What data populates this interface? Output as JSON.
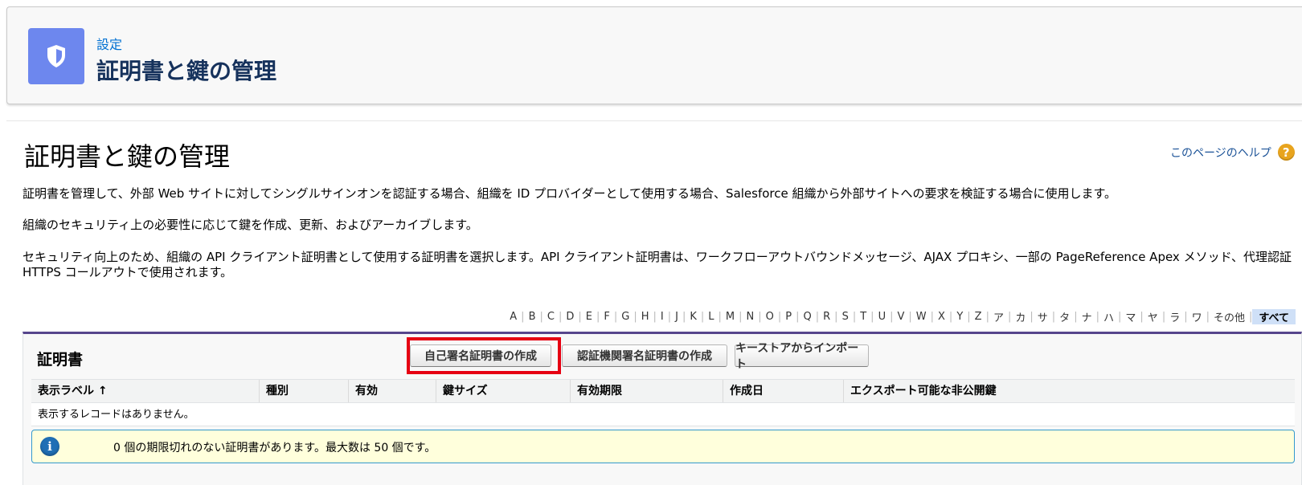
{
  "header": {
    "breadcrumb": "設定",
    "title": "証明書と鍵の管理",
    "icon": "shield-icon",
    "icon_color": "#6d87ee"
  },
  "page": {
    "title": "証明書と鍵の管理",
    "help_link": "このページのヘルプ",
    "help_icon": "question-icon",
    "descriptions": [
      "証明書を管理して、外部 Web サイトに対してシングルサインオンを認証する場合、組織を ID プロバイダーとして使用する場合、Salesforce 組織から外部サイトへの要求を検証する場合に使用します。",
      "組織のセキュリティ上の必要性に応じて鍵を作成、更新、およびアーカイブします。",
      "セキュリティ向上のため、組織の API クライアント証明書として使用する証明書を選択します。API クライアント証明書は、ワークフローアウトバウンドメッセージ、AJAX プロキシ、一部の PageReference Apex メソッド、代理認証 HTTPS コールアウトで使用されます。"
    ]
  },
  "alpha_filter": {
    "letters": [
      "A",
      "B",
      "C",
      "D",
      "E",
      "F",
      "G",
      "H",
      "I",
      "J",
      "K",
      "L",
      "M",
      "N",
      "O",
      "P",
      "Q",
      "R",
      "S",
      "T",
      "U",
      "V",
      "W",
      "X",
      "Y",
      "Z",
      "ア",
      "カ",
      "サ",
      "タ",
      "ナ",
      "ハ",
      "マ",
      "ヤ",
      "ラ",
      "ワ",
      "その他",
      "すべて"
    ],
    "active": "すべて"
  },
  "certificates": {
    "title": "証明書",
    "buttons": {
      "create_self_signed": "自己署名証明書の作成",
      "create_ca_signed": "認証機関署名証明書の作成",
      "import_keystore": "キーストアからインポート"
    },
    "columns": [
      "表示ラベル ↑",
      "種別",
      "有効",
      "鍵サイズ",
      "有効期限",
      "作成日",
      "エクスポート可能な非公開鍵"
    ],
    "empty_message": "表示するレコードはありません。",
    "info_message": "0 個の期限切れのない証明書があります。最大数は 50 個です。",
    "info_icon": "info-icon",
    "accent_color": "#56458c",
    "highlight_color": "#e60012"
  }
}
